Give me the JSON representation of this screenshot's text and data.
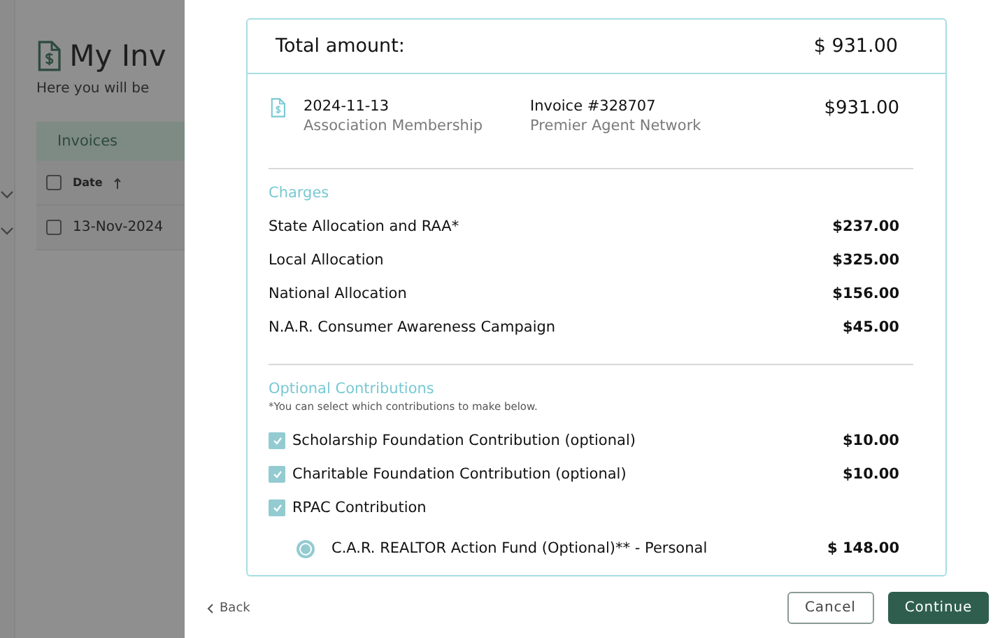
{
  "background": {
    "title": "My Inv",
    "subtitle": "Here you will be",
    "table": {
      "tab": "Invoices",
      "column": "Date",
      "rows": [
        {
          "date": "13-Nov-2024",
          "checked": false
        }
      ],
      "header_checked": false
    }
  },
  "modal": {
    "total_label": "Total amount:",
    "total_value": "$ 931.00",
    "invoice": {
      "date": "2024-11-13",
      "type": "Association Membership",
      "number": "Invoice #328707",
      "org": "Premier Agent Network",
      "amount": "$931.00"
    },
    "charges": {
      "heading": "Charges",
      "items": [
        {
          "label": "State Allocation and RAA*",
          "amount": "$237.00"
        },
        {
          "label": "Local Allocation",
          "amount": "$325.00"
        },
        {
          "label": "National Allocation",
          "amount": "$156.00"
        },
        {
          "label": "N.A.R. Consumer Awareness Campaign",
          "amount": "$45.00"
        }
      ]
    },
    "optional": {
      "heading": "Optional Contributions",
      "note": "*You can select which contributions to make below.",
      "items": [
        {
          "kind": "checkbox",
          "label": "Scholarship Foundation Contribution (optional)",
          "amount": "$10.00",
          "checked": true
        },
        {
          "kind": "checkbox",
          "label": "Charitable Foundation Contribution (optional)",
          "amount": "$10.00",
          "checked": true
        },
        {
          "kind": "checkbox",
          "label": "RPAC Contribution",
          "checked": true
        },
        {
          "kind": "radio",
          "label": "C.A.R. REALTOR Action Fund (Optional)** - Personal",
          "amount": "$ 148.00",
          "selected": true
        }
      ]
    }
  },
  "footer": {
    "back": "Back",
    "cancel": "Cancel",
    "continue": "Continue"
  }
}
